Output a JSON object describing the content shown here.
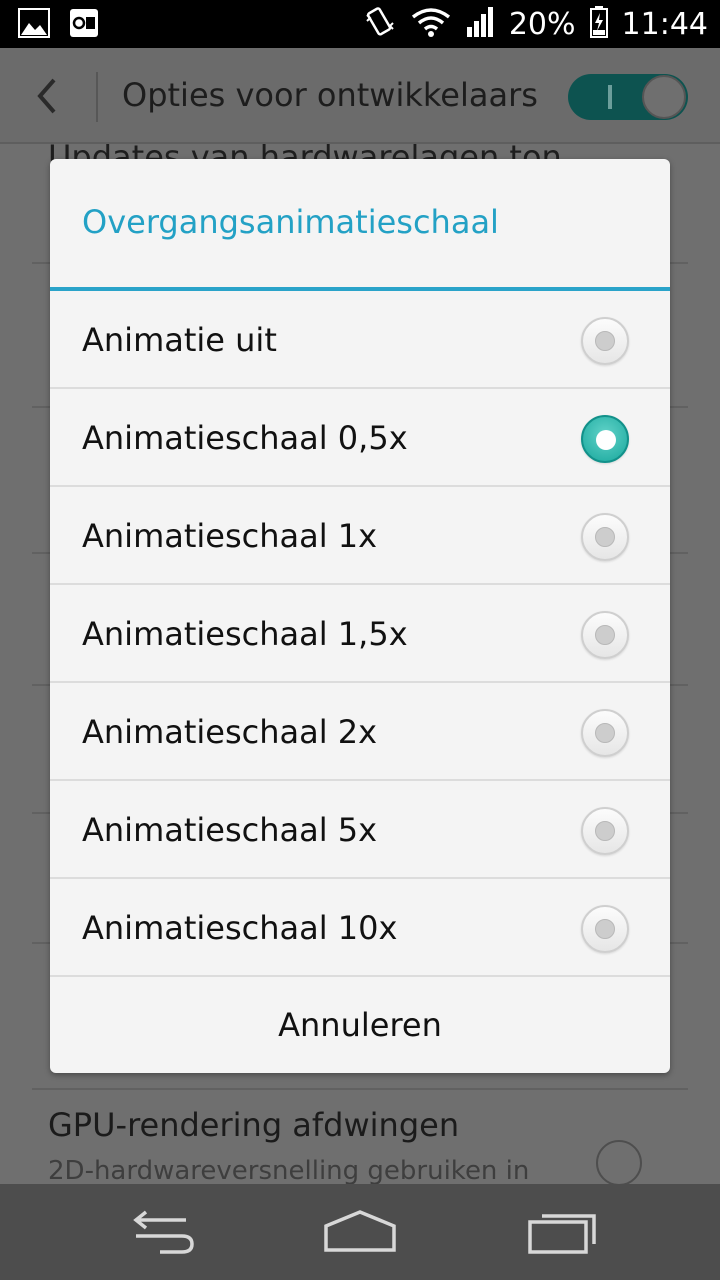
{
  "status_bar": {
    "battery": "20%",
    "time": "11:44",
    "icons": [
      "gallery-icon",
      "outlook-icon",
      "vibrate-icon",
      "wifi-icon",
      "signal-icon",
      "battery-charging-icon"
    ]
  },
  "app_bar": {
    "title": "Opties voor ontwikkelaars",
    "master_toggle": "on"
  },
  "background_list": {
    "partial_title": "Updates van hardwarelagen ton",
    "gpu_title": "GPU-rendering afdwingen",
    "gpu_subtitle": "2D-hardwareversnelling gebruiken in"
  },
  "dialog": {
    "title": "Overgangsanimatieschaal",
    "options": [
      {
        "label": "Animatie uit",
        "selected": false
      },
      {
        "label": "Animatieschaal 0,5x",
        "selected": true
      },
      {
        "label": "Animatieschaal 1x",
        "selected": false
      },
      {
        "label": "Animatieschaal 1,5x",
        "selected": false
      },
      {
        "label": "Animatieschaal 2x",
        "selected": false
      },
      {
        "label": "Animatieschaal 5x",
        "selected": false
      },
      {
        "label": "Animatieschaal 10x",
        "selected": false
      }
    ],
    "cancel_label": "Annuleren"
  },
  "colors": {
    "accent": "#23a1c5",
    "radio_selected": "#1fb5aa"
  },
  "nav_bar": {
    "icons": [
      "back-icon",
      "home-icon",
      "recent-apps-icon"
    ]
  }
}
